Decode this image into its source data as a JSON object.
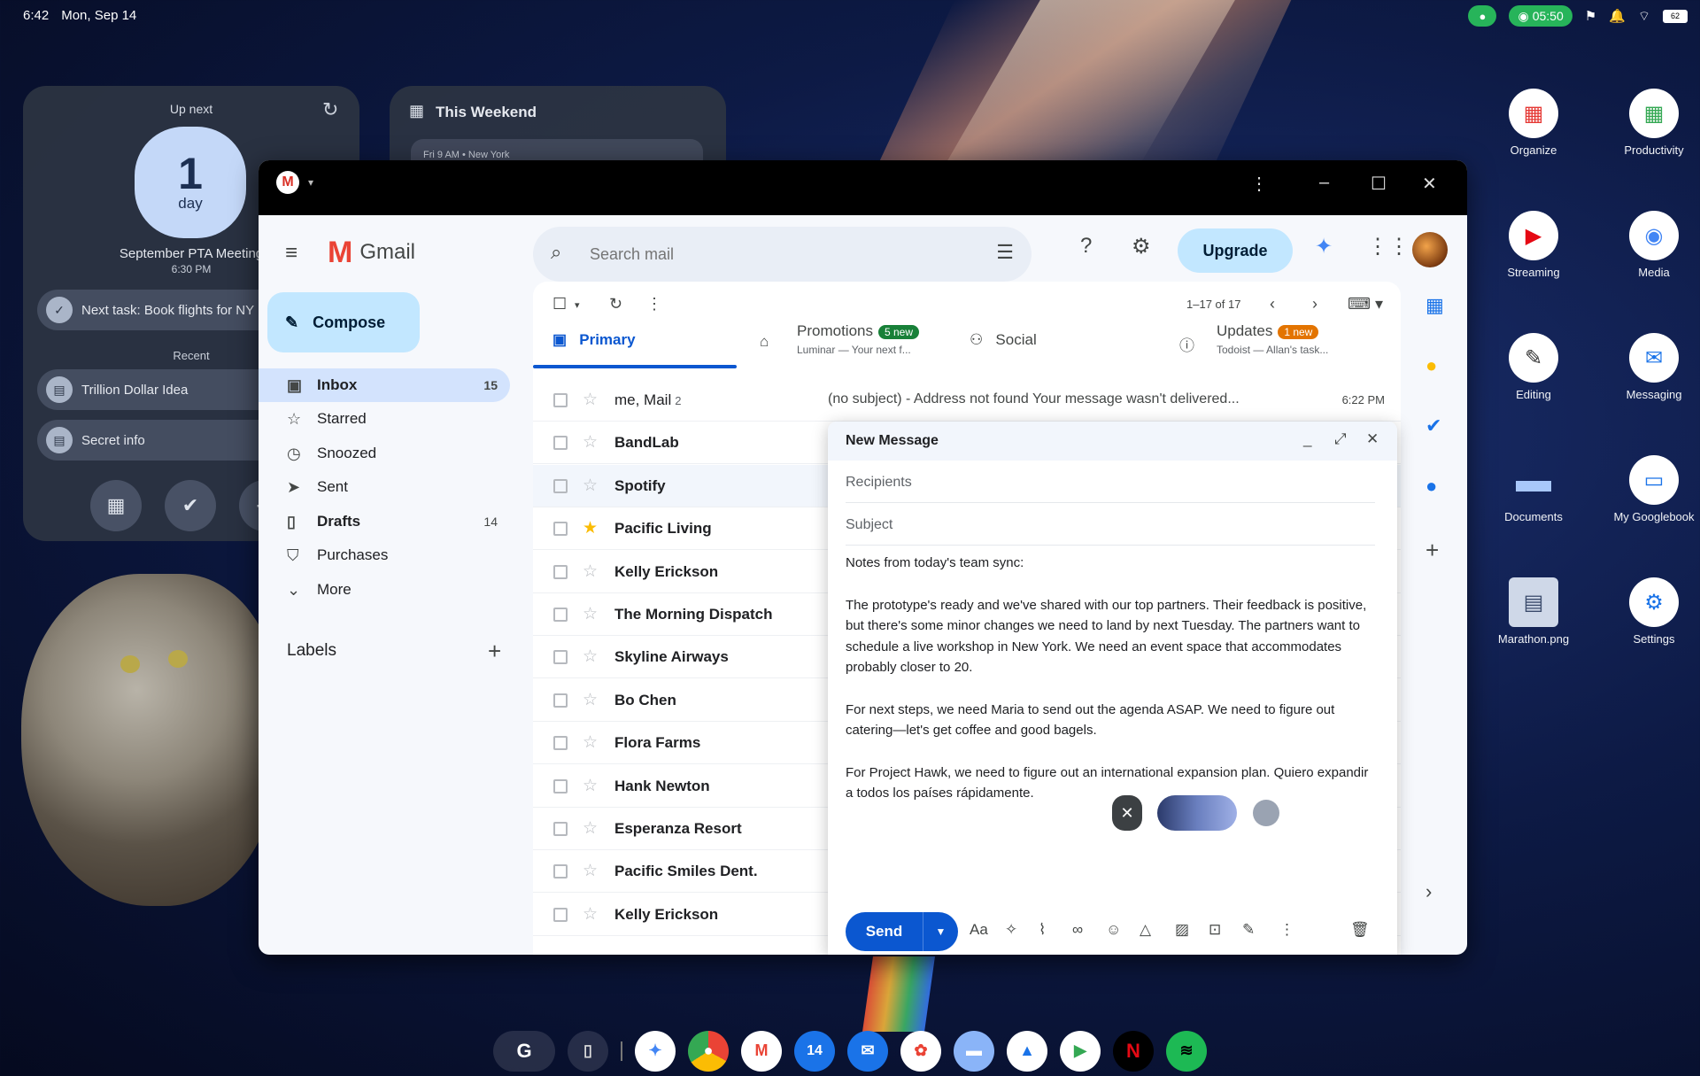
{
  "status_bar": {
    "time": "6:42",
    "date": "Mon, Sep 14",
    "recording": "05:50",
    "battery": "62"
  },
  "widget_upnext": {
    "title": "Up next",
    "days_number": "1",
    "days_unit": "day",
    "event_title": "September PTA Meeting",
    "event_time": "6:30 PM",
    "next_task": "Next task: Book flights for NY",
    "recent_label": "Recent",
    "recent": [
      "Trillion Dollar Idea",
      "Secret info"
    ]
  },
  "widget_weekend": {
    "title": "This Weekend",
    "subtitle": "Fri 9 AM • New York"
  },
  "launcher": [
    {
      "label": "Organize"
    },
    {
      "label": "Productivity"
    },
    {
      "label": "Streaming"
    },
    {
      "label": "Media"
    },
    {
      "label": "Editing"
    },
    {
      "label": "Messaging"
    },
    {
      "label": "Documents"
    },
    {
      "label": "My Googlebook"
    },
    {
      "label": "Marathon.png"
    },
    {
      "label": "Settings"
    }
  ],
  "gmail": {
    "brand": "Gmail",
    "search_placeholder": "Search mail",
    "upgrade": "Upgrade",
    "compose": "Compose",
    "nav": [
      {
        "label": "Inbox",
        "count": "15"
      },
      {
        "label": "Starred",
        "count": ""
      },
      {
        "label": "Snoozed",
        "count": ""
      },
      {
        "label": "Sent",
        "count": ""
      },
      {
        "label": "Drafts",
        "count": "14"
      },
      {
        "label": "Purchases",
        "count": ""
      },
      {
        "label": "More",
        "count": ""
      }
    ],
    "labels_title": "Labels",
    "pager": "1–17 of 17",
    "tabs": {
      "primary": "Primary",
      "promotions": "Promotions",
      "promotions_badge": "5 new",
      "promotions_sub": "Luminar — Your next f...",
      "social": "Social",
      "updates": "Updates",
      "updates_badge": "1 new",
      "updates_sub": "Todoist — Allan's task..."
    },
    "rows": [
      {
        "sender": "me, Mail",
        "count": "2",
        "subject": "(no subject) - Address not found Your message wasn't delivered...",
        "time": "6:22 PM",
        "starred": false
      },
      {
        "sender": "BandLab",
        "count": "",
        "subject": "",
        "time": "",
        "starred": false
      },
      {
        "sender": "Spotify",
        "count": "",
        "subject": "",
        "time": "",
        "starred": false
      },
      {
        "sender": "Pacific Living",
        "count": "",
        "subject": "",
        "time": "",
        "starred": true
      },
      {
        "sender": "Kelly Erickson",
        "count": "",
        "subject": "",
        "time": "",
        "starred": false
      },
      {
        "sender": "The Morning Dispatch",
        "count": "",
        "subject": "",
        "time": "",
        "starred": false
      },
      {
        "sender": "Skyline Airways",
        "count": "",
        "subject": "",
        "time": "",
        "starred": false
      },
      {
        "sender": "Bo Chen",
        "count": "",
        "subject": "",
        "time": "",
        "starred": false
      },
      {
        "sender": "Flora Farms",
        "count": "",
        "subject": "",
        "time": "",
        "starred": false
      },
      {
        "sender": "Hank Newton",
        "count": "",
        "subject": "",
        "time": "",
        "starred": false
      },
      {
        "sender": "Esperanza Resort",
        "count": "",
        "subject": "",
        "time": "",
        "starred": false
      },
      {
        "sender": "Pacific Smiles Dent.",
        "count": "",
        "subject": "",
        "time": "",
        "starred": false
      },
      {
        "sender": "Kelly Erickson",
        "count": "",
        "subject": "",
        "time": "",
        "starred": false
      }
    ]
  },
  "compose": {
    "title": "New Message",
    "recipients_placeholder": "Recipients",
    "subject_placeholder": "Subject",
    "body": [
      "Notes from today's team sync:",
      "The prototype's ready and we've shared with our top partners. Their feedback is positive, but there's some minor changes we need to land by next Tuesday. The partners want to schedule a live workshop in New York. We need an event space that accommodates probably closer to 20.",
      "For next steps, we need Maria to send out the agenda ASAP. We need to figure out catering—let's get coffee and good bagels.",
      "For Project Hawk, we need to figure out an international expansion plan. Quiero expandir a todos los países rápidamente."
    ],
    "send": "Send",
    "format_label": "Aa"
  },
  "colors": {
    "accent": "#0b57d0",
    "compose_button": "#c2e7ff",
    "promotions_badge": "#188038",
    "updates_badge": "#e37400"
  }
}
